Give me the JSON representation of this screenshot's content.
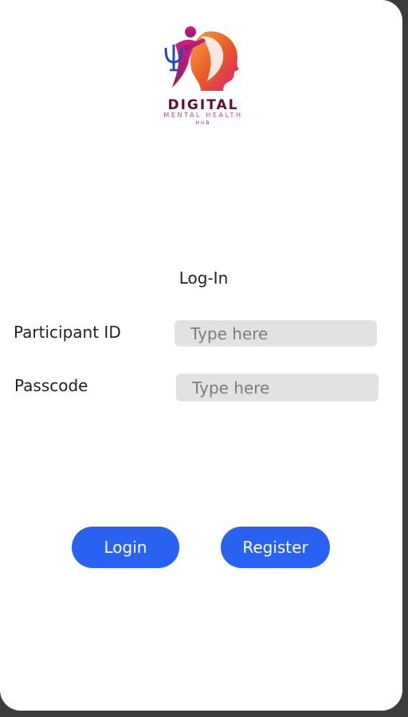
{
  "logo": {
    "word_primary": "DIGITAL",
    "word_secondary": "MENTAL HEALTH",
    "word_tertiary": "HUB",
    "colors": {
      "magenta": "#d41e7f",
      "orange": "#f28c28",
      "plum": "#5c1136",
      "blue": "#1f4bb8"
    }
  },
  "form": {
    "title": "Log-In",
    "participant_id": {
      "label": "Participant ID",
      "placeholder": "Type here",
      "value": ""
    },
    "passcode": {
      "label": "Passcode",
      "placeholder": "Type here",
      "value": ""
    }
  },
  "actions": {
    "login_label": "Login",
    "register_label": "Register",
    "accent": "#2962f0"
  }
}
